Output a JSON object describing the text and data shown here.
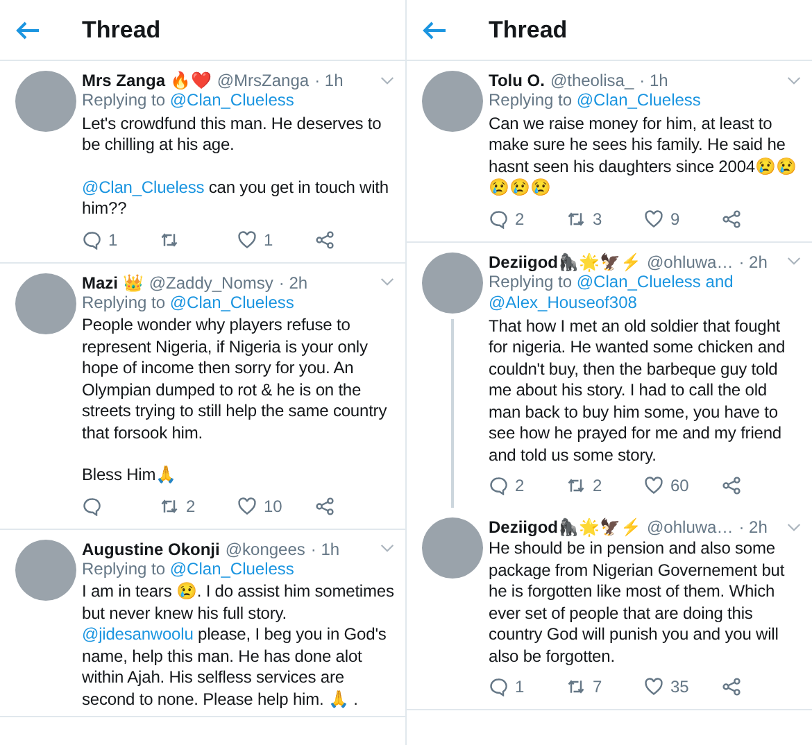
{
  "panels": [
    {
      "header": {
        "title": "Thread"
      },
      "tweets": [
        {
          "name": "Mrs Zanga 🔥❤️",
          "handle": "@MrsZanga",
          "time": "· 1h",
          "replying": [
            {
              "kind": "text",
              "text": "Replying to "
            },
            {
              "kind": "mention",
              "text": "@Clan_Clueless"
            }
          ],
          "paragraphs": [
            [
              {
                "kind": "text",
                "text": "Let's crowdfund this man. He deserves to be chilling at his age."
              }
            ],
            [
              {
                "kind": "mention",
                "text": "@Clan_Clueless"
              },
              {
                "kind": "text",
                "text": " can you get in touch with him??"
              }
            ]
          ],
          "actions": {
            "replies": "1",
            "likes": "1"
          }
        },
        {
          "name": "Mazi 👑",
          "handle": "@Zaddy_Nomsy",
          "time": "· 2h",
          "replying": [
            {
              "kind": "text",
              "text": "Replying to "
            },
            {
              "kind": "mention",
              "text": "@Clan_Clueless"
            }
          ],
          "paragraphs": [
            [
              {
                "kind": "text",
                "text": "People wonder why players refuse to represent Nigeria, if Nigeria is your only hope of income then sorry for you. An Olympian dumped to rot & he is on the streets trying to still help the same country that forsook him."
              }
            ],
            [
              {
                "kind": "text",
                "text": "Bless Him🙏"
              }
            ]
          ],
          "actions": {
            "retweets": "2",
            "likes": "10"
          }
        },
        {
          "name": "Augustine Okonji",
          "handle": "@kongees",
          "time": "· 1h",
          "replying": [
            {
              "kind": "text",
              "text": "Replying to "
            },
            {
              "kind": "mention",
              "text": "@Clan_Clueless"
            }
          ],
          "paragraphs": [
            [
              {
                "kind": "text",
                "text": "I am in tears 😢.  I do assist him sometimes but never knew his full story. "
              },
              {
                "kind": "mention",
                "text": "@jidesanwoolu"
              },
              {
                "kind": "text",
                "text": " please, I beg you in God's name, help this man. He has done alot within Ajah. His selfless services are second to none. Please help him. 🙏 ."
              }
            ]
          ]
        }
      ]
    },
    {
      "header": {
        "title": "Thread"
      },
      "tweets": [
        {
          "name": "Tolu O.",
          "handle": "@theolisa_",
          "time": "· 1h",
          "replying": [
            {
              "kind": "text",
              "text": "Replying to "
            },
            {
              "kind": "mention",
              "text": "@Clan_Clueless"
            }
          ],
          "paragraphs": [
            [
              {
                "kind": "text",
                "text": "Can we raise money for him, at least to make sure he sees his family. He said he hasnt seen his daughters since 2004😢😢😢😢😢"
              }
            ]
          ],
          "actions": {
            "replies": "2",
            "retweets": "3",
            "likes": "9"
          }
        },
        {
          "name": "Deziigod🦍🌟🦅⚡",
          "handle": "@ohluwa…",
          "time": "· 2h",
          "thread_line": true,
          "replying": [
            {
              "kind": "text",
              "text": "Replying to "
            },
            {
              "kind": "mention",
              "text": "@Clan_Clueless and"
            },
            {
              "kind": "mention",
              "text": "@Alex_Houseof308"
            }
          ],
          "paragraphs": [
            [
              {
                "kind": "text",
                "text": "That how I met an old soldier that fought for nigeria. He wanted some chicken and couldn't buy, then the barbeque guy told me about his story. I had to call the old man back to buy him some, you have to see how he prayed for me and my friend and told us some story."
              }
            ]
          ],
          "actions": {
            "replies": "2",
            "retweets": "2",
            "likes": "60"
          }
        },
        {
          "name": "Deziigod🦍🌟🦅⚡",
          "handle": "@ohluwa…",
          "time": "· 2h",
          "paragraphs": [
            [
              {
                "kind": "text",
                "text": "He should be in pension  and also some package from Nigerian Governement but he is forgotten like most of them. Which ever set of people that are doing this country God will punish you and you will also be forgotten."
              }
            ]
          ],
          "actions": {
            "replies": "1",
            "retweets": "7",
            "likes": "35"
          }
        }
      ]
    }
  ]
}
